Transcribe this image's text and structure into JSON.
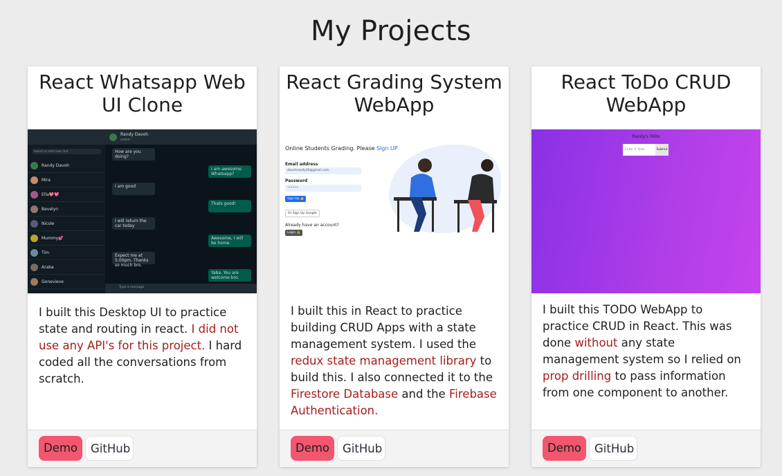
{
  "page": {
    "title": "My Projects"
  },
  "cards": [
    {
      "title": "React Whatsapp Web UI Clone",
      "body": [
        {
          "text": "I built this Desktop UI to practice state and routing in react. ",
          "hl": false
        },
        {
          "text": "I did not use any API's for this project.",
          "hl": true
        },
        {
          "text": " I hard coded all the conversations from scratch.",
          "hl": false
        }
      ],
      "demo_label": "Demo",
      "github_label": "GitHub",
      "preview": {
        "header_name": "Randy Davoh",
        "header_status": "online",
        "search_placeholder": "Search or start new chat",
        "contacts": [
          "Randy Davoh",
          "Mira",
          "Ella💖💖",
          "Bevelyn",
          "Nicole",
          "Mummy💕",
          "Tim",
          "Araba",
          "Genevieve"
        ],
        "messages": [
          {
            "text": "How are you doing?",
            "dir": "in"
          },
          {
            "text": "I am awesome. Whatsapp?",
            "dir": "out"
          },
          {
            "text": "I am good",
            "dir": "in"
          },
          {
            "text": "Thats good!",
            "dir": "out"
          },
          {
            "text": "I will return the car today",
            "dir": "in"
          },
          {
            "text": "Awesome, I will be home",
            "dir": "out"
          },
          {
            "text": "Expect me at 5:00pm. Thanks so much bro.",
            "dir": "in"
          },
          {
            "text": "Yaba. You are welcome bro.",
            "dir": "out"
          }
        ],
        "message_placeholder": "Type a message"
      }
    },
    {
      "title": "React Grading System WebApp",
      "body": [
        {
          "text": "I built this in React to practice building CRUD Apps with a state management system. I used the ",
          "hl": false
        },
        {
          "text": "redux state management library",
          "hl": true
        },
        {
          "text": " to build this. I also connected it to the ",
          "hl": false
        },
        {
          "text": "Firestore Database",
          "hl": true
        },
        {
          "text": " and the ",
          "hl": false
        },
        {
          "text": "Firebase Authentication.",
          "hl": true
        }
      ],
      "demo_label": "Demo",
      "github_label": "GitHub",
      "preview": {
        "heading": "Online Students Grading. Please ",
        "heading_link": "Sign UP",
        "email_label": "Email address",
        "email_value": "davohrandy00@gmail.com",
        "password_label": "Password",
        "password_value": "••••••",
        "signup_btn": "Sign Up 👍",
        "google_btn": "Or Sign Up Google",
        "account_text": "Already have an account?",
        "login_btn": "Login 🔒"
      }
    },
    {
      "title": "React ToDo CRUD WebApp",
      "body": [
        {
          "text": "I built this TODO WebApp to practice CRUD in React. This was done ",
          "hl": false
        },
        {
          "text": "without",
          "hl": true
        },
        {
          "text": " any state management system so I relied on ",
          "hl": false
        },
        {
          "text": "prop drilling",
          "hl": true
        },
        {
          "text": " to pass information from one component to another.",
          "hl": false
        }
      ],
      "demo_label": "Demo",
      "github_label": "GitHub",
      "preview": {
        "title": "Randy's ToDo",
        "input_placeholder": "Enter A Todo",
        "submit_label": "Submit"
      }
    }
  ],
  "colors": {
    "demo": "#f2576f",
    "highlight": "#a51d1d",
    "background": "#ececec"
  }
}
